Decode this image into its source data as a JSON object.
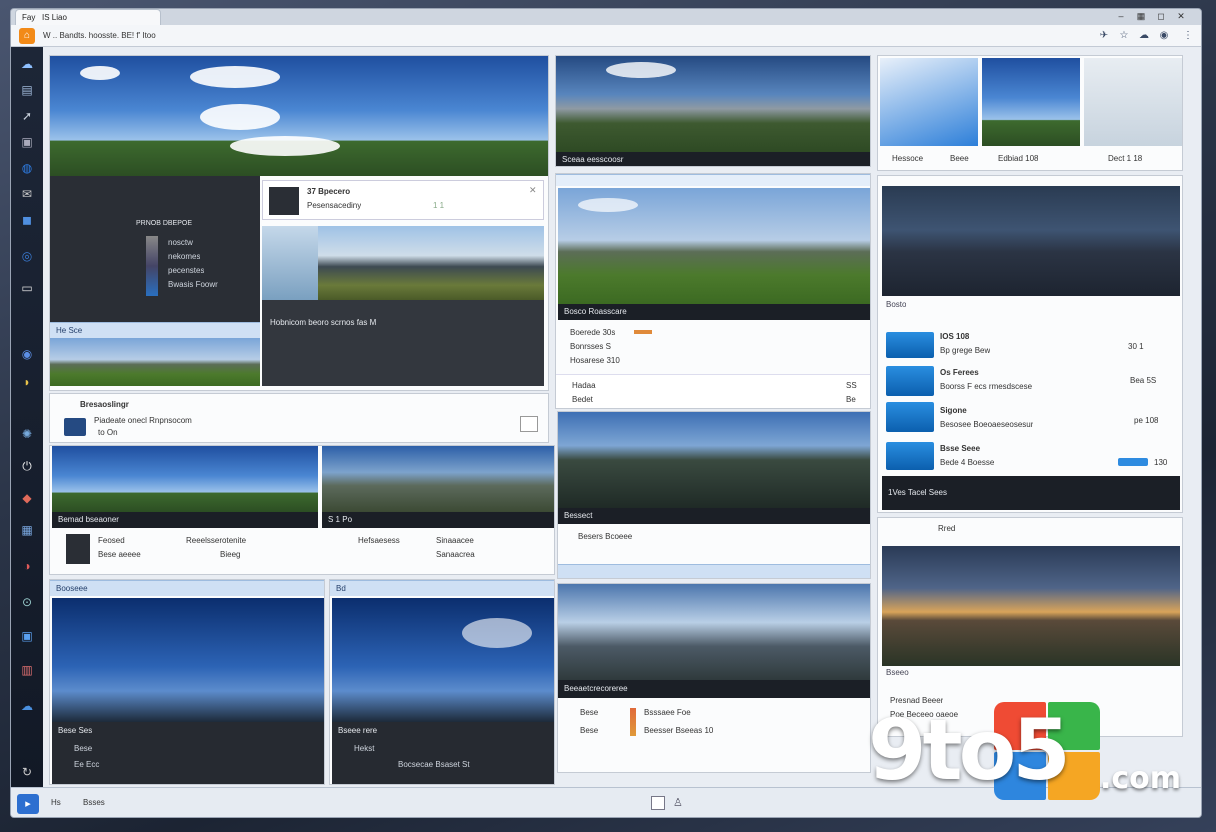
{
  "browser": {
    "tab_title": "Fay",
    "tab_sub": "IS Liao",
    "url_text": "W .. Bandts. hoosste. BE! f' Itoo",
    "home_icon": "home-icon",
    "accent": "#f28a18"
  },
  "sidebar": {
    "icons": [
      "cloud-icon",
      "folder-icon",
      "arrow-icon",
      "image-icon",
      "globe-icon",
      "chat-icon",
      "mail-icon",
      "gear-icon",
      "circle-icon",
      "moon-icon",
      "spiral-icon",
      "settings-icon",
      "power-icon",
      "box-icon",
      "contacts-icon",
      "clock-icon",
      "user-icon"
    ]
  },
  "panel_a": {
    "card_title": "37 Bpecero",
    "card_sub": "Pesensacediny",
    "card_num": "1 1",
    "list_header": "PRNOB DBEPOE",
    "list_rows": [
      "nosctw",
      "nekomes",
      "pecenstes",
      "Bwasis Foowr"
    ],
    "caption": "Hobnicom beoro scrnos fas M",
    "strip_label": "He Sce",
    "footer_title": "Bresaoslingr",
    "footer_sub": "Piadeate onecl Rnpnsocom",
    "footer_sub2": "to On"
  },
  "panel_b": {
    "caption": "Sceaa eesscoosr"
  },
  "panel_c": {
    "caption": "Bosco Roasscare",
    "rows": [
      "Boerede 30s",
      "Bonrsses S",
      "Hosarese 310"
    ]
  },
  "panel_d": {
    "header": "Hessoce",
    "col2": "Beee",
    "col3": "Edbiad 108",
    "col4": "Dect 1 18"
  },
  "panel_e": {
    "caption": "Bosto",
    "list": [
      {
        "title": "IOS 108",
        "sub": "Bp grege Bew"
      },
      {
        "title": "Os Ferees",
        "sub": "Boorss F ecs rmesdscese"
      },
      {
        "title": "Sigone",
        "sub": "Besosee Boeoaeseosesur"
      },
      {
        "title": "Bsse Seee",
        "sub": "Bede 4 Boesse"
      }
    ],
    "side_vals": [
      "30 1",
      "Bea 5S",
      "pe 108",
      "130"
    ],
    "footer": "1Ves Tacel Sees"
  },
  "panel_f": {
    "row1": "Hadaa",
    "row2": "Bedet",
    "right1": "SS",
    "right2": "Be"
  },
  "panel_g": {
    "caption": "Bessect",
    "row": "Besers Bcoeee"
  },
  "row3": {
    "left": {
      "caption": "Bemad bseaoner",
      "t1": "Feosed",
      "t2": "Bese aeeee",
      "t3": "Reeelsserotenite",
      "t4": "Bieeg"
    },
    "right": {
      "caption": "S 1 Po",
      "t1": "Hefsaesess",
      "t2": "Sinaaacee",
      "t3": "Sanaacrea"
    }
  },
  "panel_h": {
    "header": "Rred",
    "caption": "Bseeo",
    "t1": "Presnad Beeer",
    "t2": "Poe Beceeo oaeoe"
  },
  "row4": {
    "left": {
      "header": "Booseee",
      "footer": "Bese Ses",
      "rows": [
        "Bese",
        "Ee Ecc"
      ]
    },
    "mid": {
      "header": "Bd",
      "footer": "Bseee rere",
      "rows": [
        "Hekst",
        "Bocsecae Bsaset St"
      ]
    },
    "right": {
      "header": "Beeaetcrecoreree",
      "rows": [
        {
          "a": "Bese",
          "b": "Bsssaee Foe"
        },
        {
          "a": "Bese",
          "b": "Beesser Bseeas 10"
        }
      ]
    }
  },
  "taskbar": {
    "left_label": "Hs",
    "left_label2": "Bsses"
  },
  "watermark": {
    "part1": "9to5",
    "part2": ".com"
  }
}
